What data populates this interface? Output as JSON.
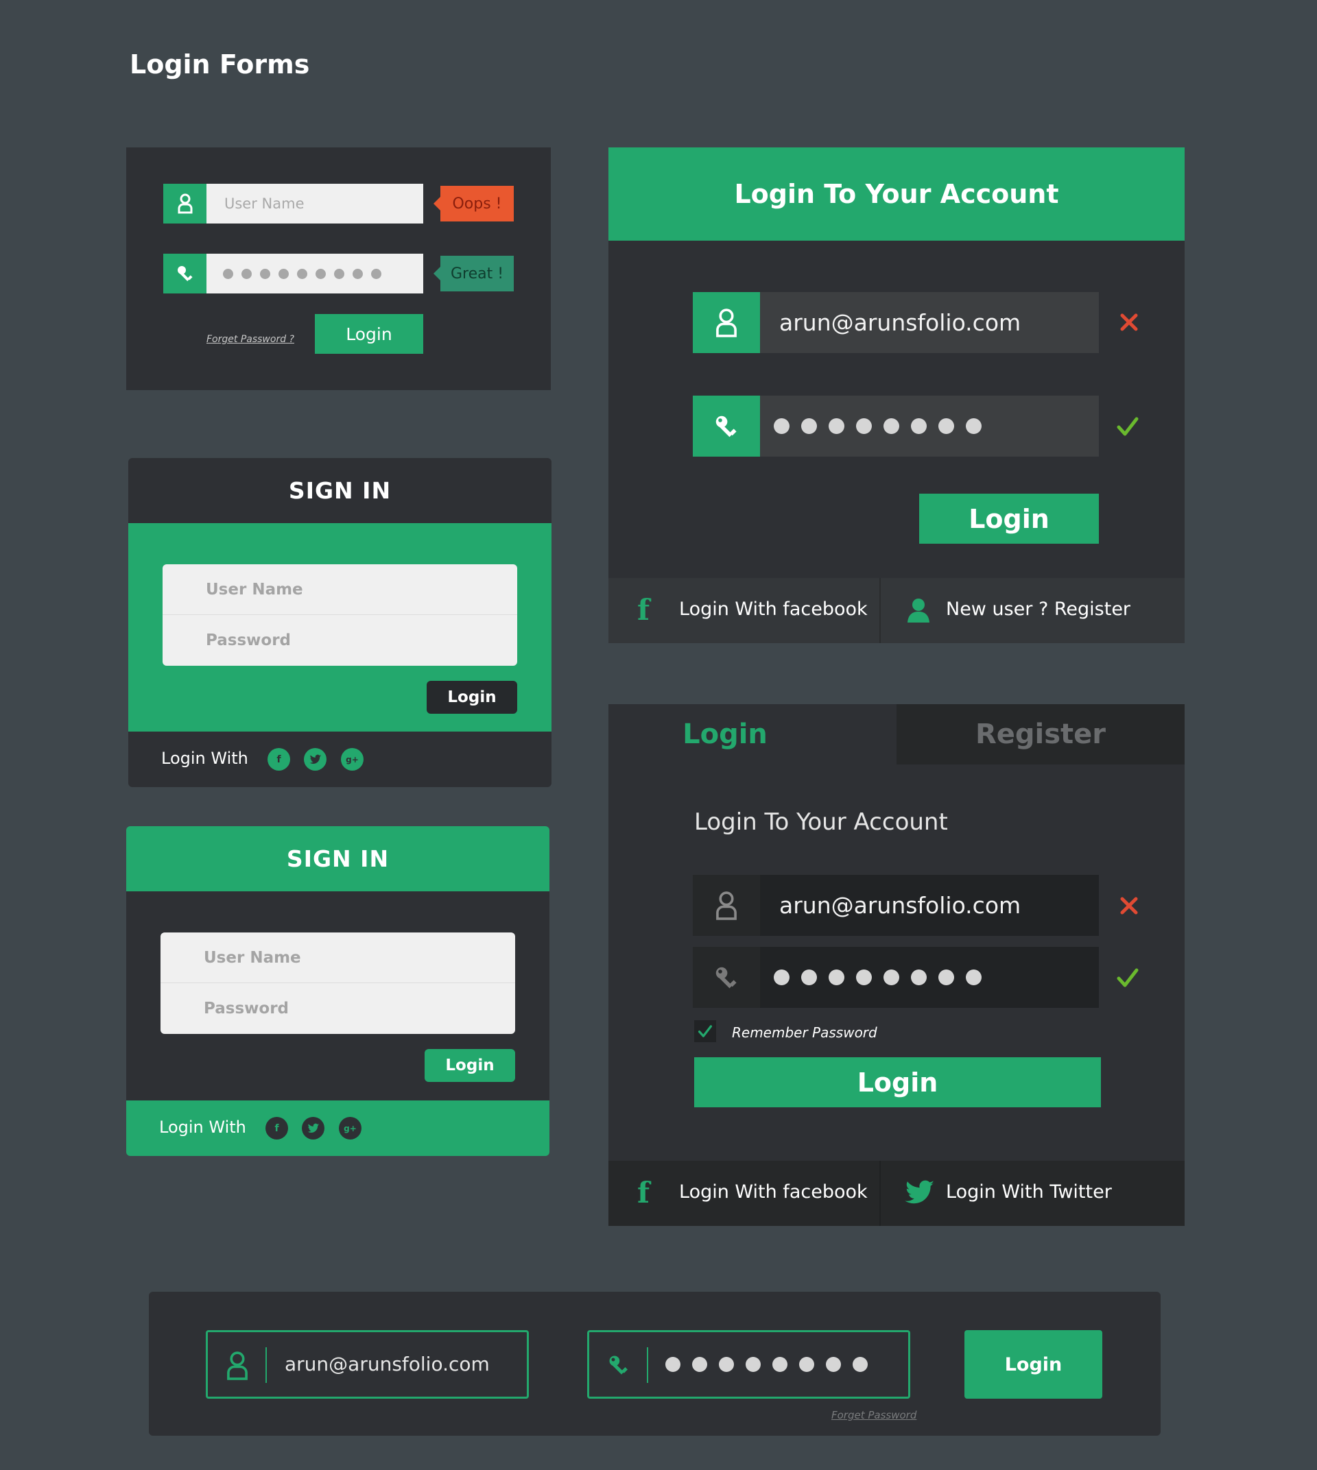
{
  "page": {
    "title": "Login Forms"
  },
  "colors": {
    "accent": "#23a86d",
    "error": "#e9582f",
    "success": "#2f8f6f",
    "check": "#6ab92e",
    "cross": "#e04a33"
  },
  "form1": {
    "username_placeholder": "User Name",
    "oops": "Oops !",
    "great": "Great !",
    "forgot": "Forget Password ?",
    "login": "Login"
  },
  "form2": {
    "header": "SIGN IN",
    "username_placeholder": "User Name",
    "password_placeholder": "Password",
    "login": "Login",
    "login_with": "Login With",
    "social": [
      "f",
      "t",
      "g+"
    ]
  },
  "form3": {
    "header": "SIGN IN",
    "username_placeholder": "User Name",
    "password_placeholder": "Password",
    "login": "Login",
    "login_with": "Login With",
    "social": [
      "f",
      "t",
      "g+"
    ]
  },
  "form4": {
    "header": "Login To Your Account",
    "email": "arun@arunsfolio.com",
    "login": "Login",
    "facebook": "Login With facebook",
    "register": "New user ? Register"
  },
  "form5": {
    "tab_login": "Login",
    "tab_register": "Register",
    "subtitle": "Login To Your Account",
    "email": "arun@arunsfolio.com",
    "remember": "Remember Password",
    "login": "Login",
    "facebook": "Login With facebook",
    "twitter": "Login With Twitter"
  },
  "form6": {
    "email": "arun@arunsfolio.com",
    "forgot": "Forget Password",
    "login": "Login"
  }
}
